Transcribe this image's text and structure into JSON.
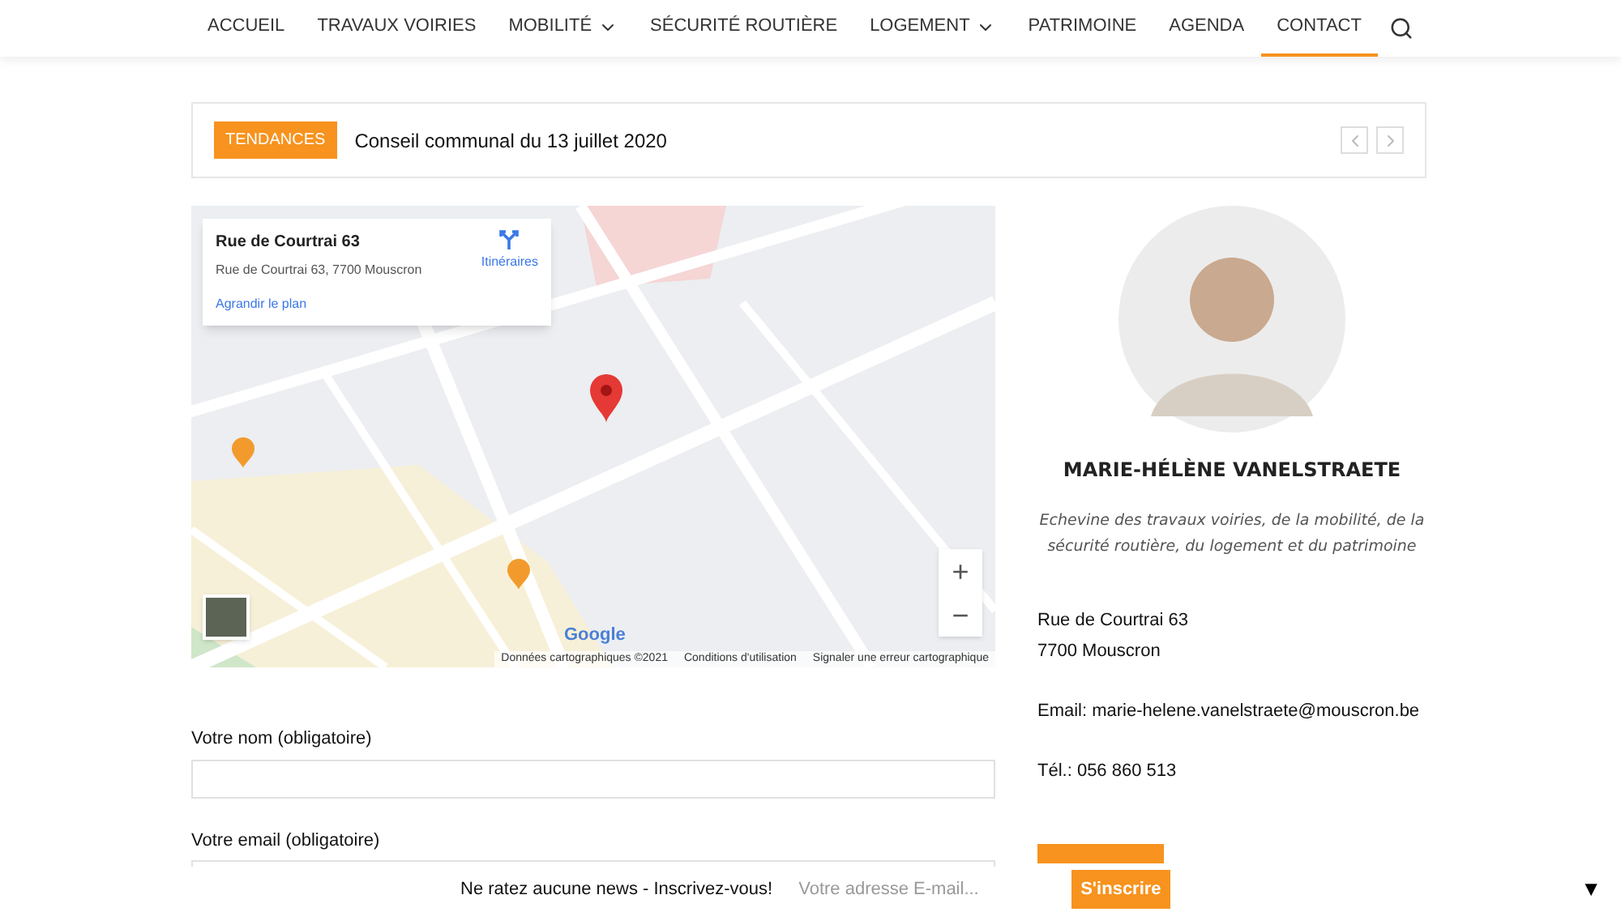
{
  "nav": {
    "items": [
      {
        "label": "ACCUEIL",
        "selected": false,
        "dropdown": false
      },
      {
        "label": "TRAVAUX VOIRIES",
        "selected": false,
        "dropdown": false
      },
      {
        "label": "MOBILITÉ",
        "selected": false,
        "dropdown": true
      },
      {
        "label": "SÉCURITÉ ROUTIÈRE",
        "selected": false,
        "dropdown": false
      },
      {
        "label": "LOGEMENT",
        "selected": false,
        "dropdown": true
      },
      {
        "label": "PATRIMOINE",
        "selected": false,
        "dropdown": false
      },
      {
        "label": "AGENDA",
        "selected": false,
        "dropdown": false
      },
      {
        "label": "CONTACT",
        "selected": true,
        "dropdown": false
      }
    ]
  },
  "ticker": {
    "badge": "TENDANCES",
    "headline": "Conseil communal du 13 juillet 2020"
  },
  "map": {
    "card": {
      "title": "Rue de Courtrai 63",
      "address": "Rue de Courtrai 63, 7700 Mouscron",
      "directions": "Itinéraires",
      "enlarge": "Agrandir le plan"
    },
    "zoom_in": "+",
    "zoom_out": "−",
    "logo": "Google",
    "attribution": [
      "Données cartographiques ©2021",
      "Conditions d'utilisation",
      "Signaler une erreur cartographique"
    ]
  },
  "form": {
    "fields": [
      {
        "label": "Votre nom (obligatoire)"
      },
      {
        "label": "Votre email (obligatoire)"
      }
    ]
  },
  "profile": {
    "name": "MARIE-HÉLÈNE VANELSTRAETE",
    "role": "Echevine des travaux voiries, de la mobilité, de la sécurité routière, du logement et du patrimoine",
    "address": [
      "Rue de Courtrai 63",
      "7700 Mouscron"
    ],
    "email": "Email: marie-helene.vanelstraete@mouscron.be",
    "phone": "Tél.: 056 860 513"
  },
  "newsletter": {
    "text": "Ne ratez aucune news - Inscrivez-vous!",
    "placeholder": "Votre adresse E-mail...",
    "button": "S'inscrire"
  },
  "scroll_down": "▼"
}
